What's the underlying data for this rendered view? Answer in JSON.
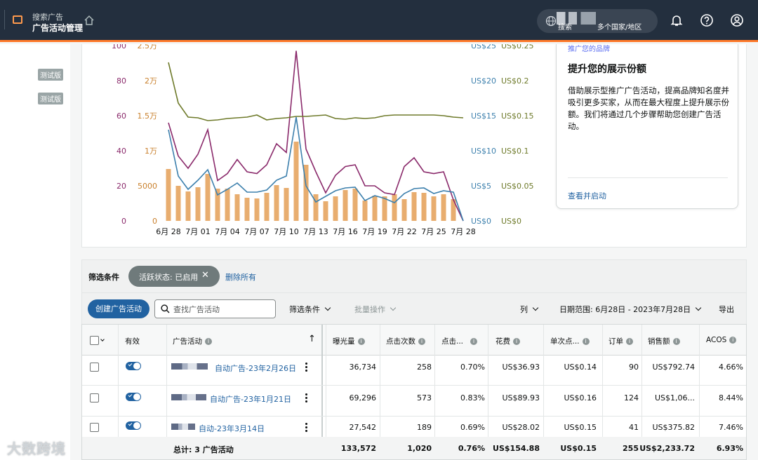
{
  "header": {
    "app_small": "搜索广告",
    "app_title": "广告活动管理",
    "account_blurred": "搜索",
    "account_label": "多个国家/地区"
  },
  "sidebar": {
    "badges": [
      "测试版",
      "测试版"
    ]
  },
  "chart_data": {
    "type": "bar+line",
    "x_ticks": [
      "6月 28",
      "7月 01",
      "7月 04",
      "7月 07",
      "7月 10",
      "7月 13",
      "7月 16",
      "7月 19",
      "7月 22",
      "7月 25",
      "7月 28"
    ],
    "axes": {
      "left1": {
        "ticks": [
          "100",
          "80",
          "60",
          "40",
          "20",
          "0"
        ],
        "color": "#8a2a6b",
        "range": [
          0,
          100
        ]
      },
      "left2": {
        "ticks": [
          "2.5万",
          "2万",
          "1.5万",
          "1万",
          "5000",
          "0"
        ],
        "color": "#c9802c",
        "range": [
          0,
          25000
        ]
      },
      "right1": {
        "ticks": [
          "US$25",
          "US$20",
          "US$15",
          "US$10",
          "US$5",
          "US$0"
        ],
        "color": "#3d80ad",
        "range": [
          0,
          25
        ]
      },
      "right2": {
        "ticks": [
          "US$0.25",
          "US$0.2",
          "US$0.15",
          "US$0.1",
          "US$0.05",
          "US$0"
        ],
        "color": "#6e7a2a",
        "range": [
          0,
          0.25
        ]
      }
    },
    "bars": {
      "color": "#e8ad6f",
      "values": [
        7400,
        5000,
        4200,
        4800,
        6700,
        4600,
        4600,
        3800,
        3300,
        3200,
        4000,
        5100,
        4700,
        11300,
        8000,
        3800,
        2800,
        3500,
        4400,
        4600,
        2900,
        3600,
        3500,
        3800,
        3100,
        4100,
        4000,
        3500,
        3800,
        3100
      ]
    },
    "series": [
      {
        "color": "#8a2a6b",
        "axis": "left1",
        "values": [
          56,
          37,
          30,
          38,
          52,
          23,
          27,
          35,
          28,
          27,
          32,
          44,
          39,
          97,
          41,
          28,
          16,
          26,
          31,
          32,
          20,
          20,
          16,
          15,
          31,
          36,
          28,
          27,
          28,
          12,
          0
        ]
      },
      {
        "color": "#3d80ad",
        "axis": "right1",
        "values": [
          13,
          6.4,
          4.5,
          5.8,
          7.3,
          3.7,
          4.5,
          5.4,
          4.1,
          4.1,
          4.4,
          5.8,
          6.4,
          14.8,
          5,
          2.7,
          3.5,
          4.3,
          4.7,
          4.8,
          2.9,
          3.6,
          3.2,
          2.6,
          3.9,
          4.6,
          4.7,
          3.9,
          4.3,
          4.1,
          0
        ]
      },
      {
        "color": "#6e7a2a",
        "axis": "right2",
        "values": [
          0.226,
          0.168,
          0.148,
          0.147,
          0.143,
          0.144,
          0.146,
          0.147,
          0.148,
          0.151,
          0.144,
          0.146,
          0.147,
          0.149,
          0.149,
          0.15,
          0.151,
          0.146,
          0.145,
          0.147,
          0.146,
          0.147,
          0.15,
          0.151,
          0.151,
          0.151,
          0.151,
          0.151,
          0.15,
          0.148,
          0.147
        ]
      }
    ]
  },
  "promo": {
    "brand_link": "推广您的品牌",
    "title": "提升您的展示份额",
    "body": "借助展示型推广广告活动，提高品牌知名度并吸引更多买家，从而在最大程度上提升展示份额。我们将通过几个步骤帮助您创建广告活动。",
    "cta": "查看并启动"
  },
  "filters": {
    "label": "筛选条件",
    "chip": "活跃状态: 已启用",
    "clear_all": "删除所有"
  },
  "toolbar": {
    "create": "创建广告活动",
    "search_placeholder": "查找广告活动",
    "filter": "筛选条件",
    "bulk": "批量操作",
    "columns": "列",
    "date_range": "日期范围: 6月28日 - 2023年7月28日",
    "export": "导出"
  },
  "table": {
    "headers": [
      "有效",
      "广告活动",
      "曝光量",
      "点击次数",
      "点击...",
      "花费",
      "单次点...",
      "订单",
      "销售额",
      "ACOS"
    ],
    "rows": [
      {
        "campaign": "自动广告-23年2月26日",
        "impressions": "36,734",
        "clicks": "258",
        "ctr": "0.70%",
        "spend": "US$36.93",
        "cpc": "US$0.14",
        "orders": "90",
        "sales": "US$792.74",
        "acos": "4.66%"
      },
      {
        "campaign": "自动广告-23年1月21日",
        "impressions": "69,296",
        "clicks": "573",
        "ctr": "0.83%",
        "spend": "US$89.93",
        "cpc": "US$0.16",
        "orders": "124",
        "sales": "US$1,06...",
        "acos": "8.44%"
      },
      {
        "campaign": "自动-23年3月14日",
        "impressions": "27,542",
        "clicks": "189",
        "ctr": "0.69%",
        "spend": "US$28.02",
        "cpc": "US$0.15",
        "orders": "41",
        "sales": "US$375.82",
        "acos": "7.46%"
      }
    ],
    "total": {
      "label": "总计: 3 广告活动",
      "impressions": "133,572",
      "clicks": "1,020",
      "ctr": "0.76%",
      "spend": "US$154.88",
      "cpc": "US$0.15",
      "orders": "255",
      "sales": "US$2,233.72",
      "acos": "6.93%"
    }
  },
  "watermark": "大数跨境"
}
